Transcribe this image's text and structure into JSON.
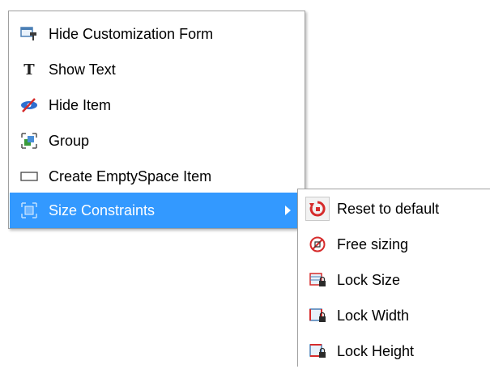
{
  "main_menu": {
    "items": [
      {
        "label": "Hide Customization Form",
        "icon": "hide-customization-form-icon"
      },
      {
        "label": "Show Text",
        "icon": "text-icon"
      },
      {
        "label": "Hide Item",
        "icon": "hide-item-icon"
      },
      {
        "label": "Group",
        "icon": "group-icon"
      },
      {
        "label": "Create EmptySpace Item",
        "icon": "empty-space-icon"
      },
      {
        "label": "Size Constraints",
        "icon": "size-constraints-icon",
        "selected": true,
        "has_submenu": true
      }
    ]
  },
  "sub_menu": {
    "items": [
      {
        "label": "Reset to default",
        "icon": "reset-icon"
      },
      {
        "label": "Free sizing",
        "icon": "free-sizing-icon"
      },
      {
        "label": "Lock Size",
        "icon": "lock-size-icon"
      },
      {
        "label": "Lock Width",
        "icon": "lock-width-icon"
      },
      {
        "label": "Lock Height",
        "icon": "lock-height-icon"
      }
    ]
  },
  "colors": {
    "selection": "#3399ff",
    "border": "#a0a0a0",
    "icon_blue": "#2e7fd0",
    "icon_red": "#d62b2b"
  }
}
